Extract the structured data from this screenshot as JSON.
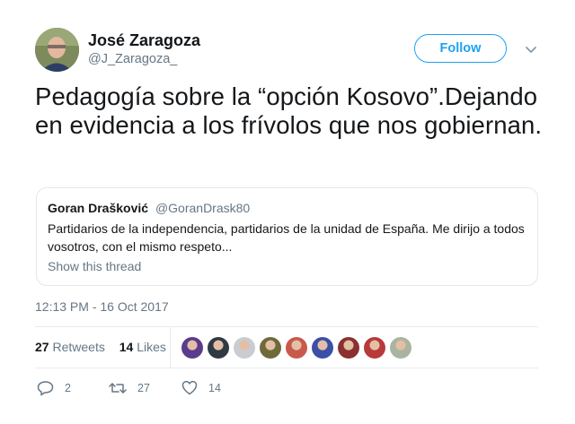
{
  "author": {
    "name": "José Zaragoza",
    "handle": "@J_Zaragoza_"
  },
  "follow_label": "Follow",
  "tweet_text": "Pedagogía sobre la “opción Kosovo”.Dejando en evidencia a los frívolos que nos gobiernan.",
  "quote": {
    "name": "Goran Drašković",
    "handle": "@GoranDrask80",
    "text": "Partidarios de la independencia, partidarios de la unidad de España. Me dirijo a todos vosotros, con el mismo respeto...",
    "show_thread": "Show this thread"
  },
  "timestamp": "12:13 PM - 16 Oct 2017",
  "stats": {
    "retweets_count": "27",
    "retweets_label": "Retweets",
    "likes_count": "14",
    "likes_label": "Likes"
  },
  "liker_avatars": [
    {
      "color": "#5a3b8c"
    },
    {
      "color": "#2f3a44"
    },
    {
      "color": "#c9ccd0"
    },
    {
      "color": "#6e6a3a"
    },
    {
      "color": "#c75a4a"
    },
    {
      "color": "#3b4fa8"
    },
    {
      "color": "#8a3030"
    },
    {
      "color": "#b83a3a"
    },
    {
      "color": "#aab4a0"
    }
  ],
  "actions": {
    "replies": "2",
    "retweets": "27",
    "likes": "14"
  },
  "colors": {
    "accent": "#1da1f2",
    "secondary_text": "#657786",
    "border": "#e1e8ed"
  }
}
